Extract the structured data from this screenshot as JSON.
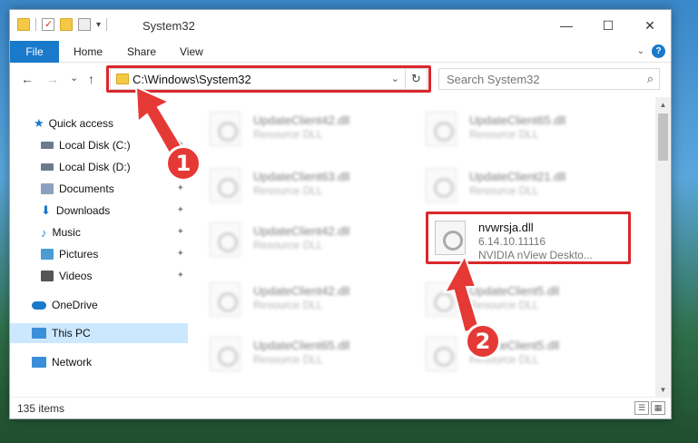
{
  "window": {
    "title": "System32",
    "controls": {
      "minimize": "—",
      "maximize": "☐",
      "close": "✕"
    }
  },
  "ribbon": {
    "file": "File",
    "tabs": [
      "Home",
      "Share",
      "View"
    ],
    "help": "?"
  },
  "navbar": {
    "back": "←",
    "forward": "→",
    "recent": "⌄",
    "up": "↑",
    "address": "C:\\Windows\\System32",
    "dropdown": "⌄",
    "refresh": "↻",
    "search_placeholder": "Search System32",
    "search_icon": "⌕"
  },
  "sidebar": {
    "items": [
      {
        "label": "Quick access",
        "icon": "star-icon",
        "color": "#1979ca",
        "pin": ""
      },
      {
        "label": "Local Disk (C:)",
        "icon": "drive-icon",
        "color": "#6b7b8c",
        "pin": "📌"
      },
      {
        "label": "Local Disk (D:)",
        "icon": "drive-icon",
        "color": "#6b7b8c",
        "pin": ""
      },
      {
        "label": "Documents",
        "icon": "documents-icon",
        "color": "#8aa2c0",
        "pin": "📌"
      },
      {
        "label": "Downloads",
        "icon": "downloads-icon",
        "color": "#1979ca",
        "pin": "📌"
      },
      {
        "label": "Music",
        "icon": "music-icon",
        "color": "#2a8fd6",
        "pin": "📌"
      },
      {
        "label": "Pictures",
        "icon": "pictures-icon",
        "color": "#4b9cd3",
        "pin": "📌"
      },
      {
        "label": "Videos",
        "icon": "videos-icon",
        "color": "#555",
        "pin": "📌"
      },
      {
        "label": "OneDrive",
        "icon": "onedrive-icon",
        "color": "#1979ca",
        "pin": ""
      },
      {
        "label": "This PC",
        "icon": "computer-icon",
        "color": "#3b8ed8",
        "pin": ""
      },
      {
        "label": "Network",
        "icon": "network-icon",
        "color": "#3b8ed8",
        "pin": ""
      }
    ]
  },
  "files": [
    {
      "name": "UpdateClient42.dll",
      "desc": "Resource DLL"
    },
    {
      "name": "UpdateClient65.dll",
      "desc": "Resource DLL"
    },
    {
      "name": "UpdateClient63.dll",
      "desc": "Resource DLL"
    },
    {
      "name": "UpdateClient21.dll",
      "desc": "Resource DLL"
    },
    {
      "name": "UpdateClient42.dll",
      "desc": "Resource DLL"
    },
    {
      "name": "nvwrsja.dll",
      "desc": "6.14.10.11116",
      "desc2": "NVIDIA nView Deskto..."
    },
    {
      "name": "UpdateClient42.dll",
      "desc": "Resource DLL"
    },
    {
      "name": "UpdateClient5.dll",
      "desc": "Resource DLL"
    },
    {
      "name": "UpdateClient65.dll",
      "desc": "Resource DLL"
    },
    {
      "name": "UpdateClient5.dll",
      "desc": "Resource DLL"
    }
  ],
  "status": {
    "items": "135 items",
    "details_view": "☰",
    "icons_view": "▦"
  },
  "annotations": {
    "badge1": "1",
    "badge2": "2",
    "color": "#e53935"
  }
}
